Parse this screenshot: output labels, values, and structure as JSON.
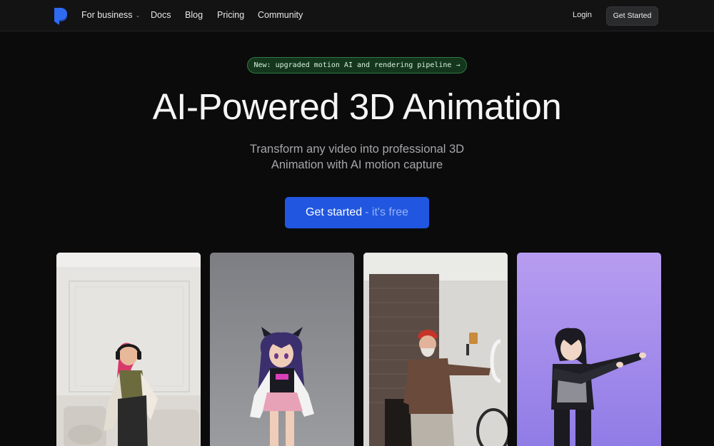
{
  "nav": {
    "logo_icon": "brand-logo-icon",
    "links": [
      {
        "label": "For business",
        "has_dropdown": true
      },
      {
        "label": "Docs"
      },
      {
        "label": "Blog"
      },
      {
        "label": "Pricing"
      },
      {
        "label": "Community"
      }
    ],
    "login_label": "Login",
    "cta_label": "Get Started"
  },
  "hero": {
    "announcement": "New: upgraded motion AI and rendering pipeline",
    "announcement_icon": "arrow-right-icon",
    "title": "AI-Powered 3D Animation",
    "subtitle_line1": "Transform any video into professional 3D",
    "subtitle_line2": "Animation with AI motion capture",
    "cta_main": "Get started",
    "cta_sub": "- it's free"
  },
  "colors": {
    "background": "#0b0b0c",
    "nav_background": "#131314",
    "accent_blue": "#2157e0",
    "pill_green": "#14361d"
  },
  "gallery": [
    {
      "subject": "woman-with-headphones-dancing"
    },
    {
      "subject": "anime-avatar-purple-hair"
    },
    {
      "subject": "older-man-red-beanie"
    },
    {
      "subject": "anime-avatar-black-hair-purple-bg"
    }
  ]
}
